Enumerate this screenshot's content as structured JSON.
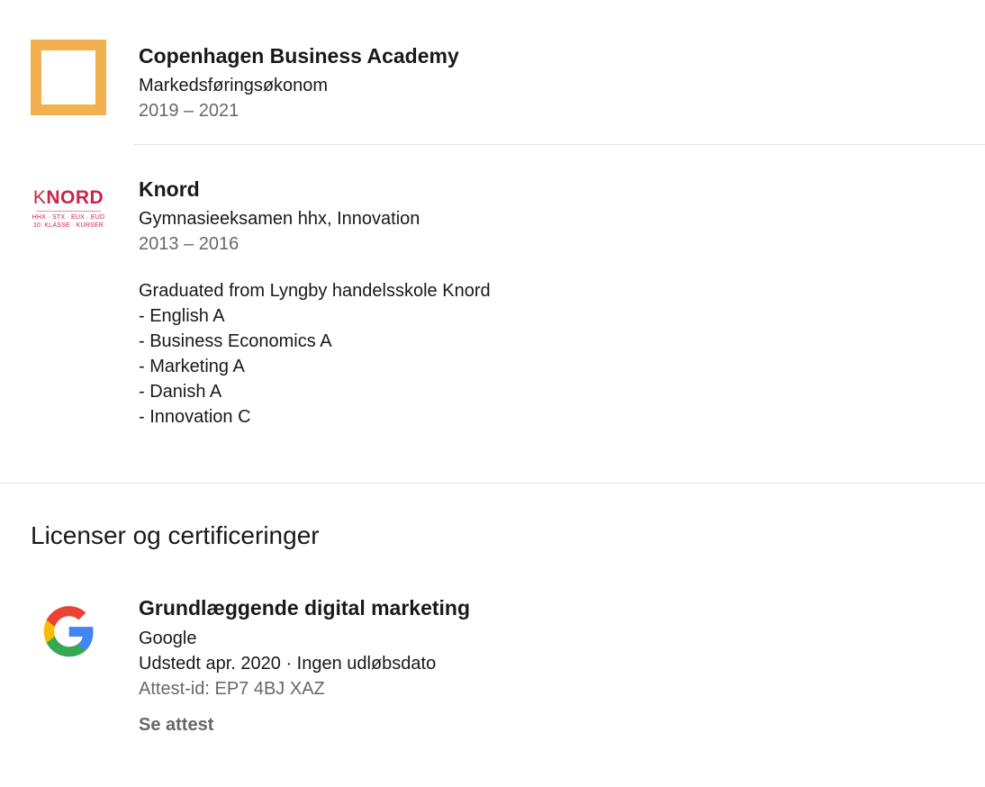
{
  "education": [
    {
      "school": "Copenhagen Business Academy",
      "degree": "Markedsføringsøkonom",
      "dates": "2019 – 2021",
      "logo_icon": "orange-square-logo",
      "logo_color": "#F2B04F"
    },
    {
      "school": "Knord",
      "degree": "Gymnasieeksamen hhx, Innovation",
      "dates": "2013 – 2016",
      "logo": {
        "k": "K",
        "rest": "NORD",
        "line1": "HHX · STX · EUX · EUD",
        "line2": "10. KLASSE · KURSER",
        "k_color": "#C9254A",
        "rest_color": "#C9254A"
      },
      "description": [
        "Graduated from Lyngby handelsskole Knord",
        "- English A",
        "- Business Economics A",
        "- Marketing A",
        "- Danish A",
        "- Innovation C"
      ]
    }
  ],
  "licenses": {
    "section_title": "Licenser og certificeringer",
    "items": [
      {
        "name": "Grundlæggende digital marketing",
        "issuer": "Google",
        "issued": "Udstedt apr. 2020 · Ingen udløbsdato",
        "credential": "Attest-id: EP7 4BJ XAZ",
        "action_label": "Se attest",
        "logo_icon": "google-g-icon"
      }
    ]
  }
}
